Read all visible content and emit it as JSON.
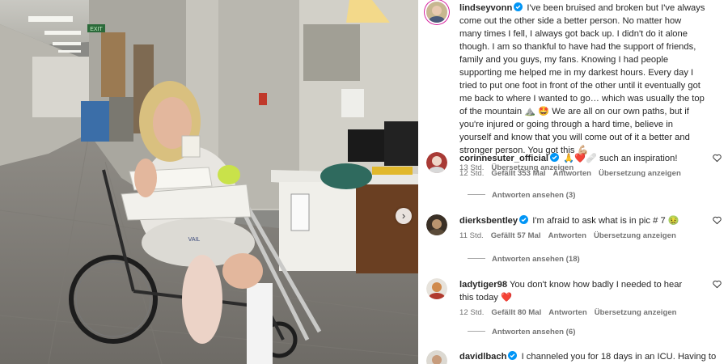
{
  "post": {
    "username": "lindseyvonn",
    "caption": "I've been bruised and broken but I've always come out the other side a better person. No matter how many times I fell, I always got back up. I didn't do it alone though. I am so thankful to have had the support of friends, family and you guys, my fans. Knowing I had people supporting me helped me in my darkest hours. Every day I tried to put one foot in front of the other until it eventually got me back to where I wanted to go… which was usually the top of the mountain ⛰️ 🤩 We are all on our own paths, but if you're injured or going through a hard time, believe in yourself and know that you will come out of it a better and stronger person. You got this 💪🏼",
    "time": "13 Std.",
    "translate": "Übersetzung anzeigen"
  },
  "image": {
    "exit_sign": "EXIT",
    "shorts_text": "VAIL"
  },
  "comments": [
    {
      "username": "corinnesuter_official",
      "text": "🙏❤️🩹 such an inspiration!",
      "time": "12 Std.",
      "likes": "Gefällt 353 Mal",
      "reply": "Antworten",
      "translate": "Übersetzung anzeigen",
      "view_replies": "Antworten ansehen (3)"
    },
    {
      "username": "dierksbentley",
      "text": "I'm afraid to ask what is in pic # 7 🤢",
      "time": "11 Std.",
      "likes": "Gefällt 57 Mal",
      "reply": "Antworten",
      "translate": "Übersetzung anzeigen",
      "view_replies": "Antworten ansehen (18)"
    },
    {
      "username": "ladytiger98",
      "text": "You don't know how badly I needed to hear this today ❤️",
      "time": "12 Std.",
      "likes": "Gefällt 80 Mal",
      "reply": "Antworten",
      "translate": "Übersetzung anzeigen",
      "view_replies": "Antworten ansehen (6)"
    },
    {
      "username": "davidlbach",
      "text": "I channeled you for 18 days in an ICU. Having to"
    }
  ],
  "colors": {
    "verified": "#0095f6",
    "text": "#262626",
    "secondary": "#737373",
    "avatar_ring": "#d6249f"
  },
  "icons": {
    "verified": "verified-badge-icon",
    "like": "heart-icon",
    "next": "chevron-right-icon"
  }
}
